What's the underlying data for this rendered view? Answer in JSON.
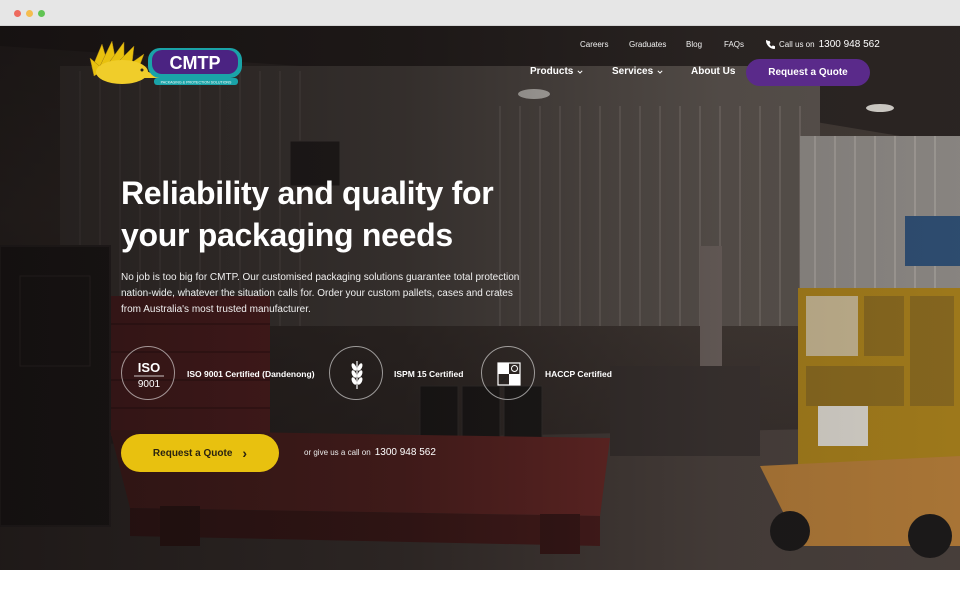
{
  "header": {
    "brand_name": "CMTP",
    "brand_tagline": "PACKAGING & PROTECTION SOLUTIONS",
    "utility_nav": [
      "Careers",
      "Graduates",
      "Blog",
      "FAQs"
    ],
    "call_prefix": "Call us on",
    "phone": "1300 948 562",
    "main_nav": [
      {
        "label": "Products",
        "has_dropdown": true
      },
      {
        "label": "Services",
        "has_dropdown": true
      },
      {
        "label": "About Us",
        "has_dropdown": false
      }
    ],
    "quote_button": "Request a Quote"
  },
  "hero": {
    "headline_line1": "Reliability and quality for",
    "headline_line2": "your packaging needs",
    "intro": "No job is too big for CMTP. Our customised packaging solutions guarantee total protection nation-wide, whatever the situation calls for. Order your custom pallets, cases and crates from Australia's most trusted manufacturer.",
    "certifications": [
      {
        "label": "ISO 9001 Certified (Dandenong)",
        "icon": "iso-9001-icon",
        "icon_text_top": "ISO",
        "icon_text_bottom": "9001"
      },
      {
        "label": "ISPM 15 Certified",
        "icon": "wheat-icon"
      },
      {
        "label": "HACCP Certified",
        "icon": "haccp-icon"
      }
    ],
    "cta_button": "Request a Quote",
    "cta_arrow": "›",
    "call_text": "or give us a call on",
    "call_phone": "1300 948 562"
  },
  "colors": {
    "accent_purple": "#5a2a8a",
    "accent_yellow": "#e8c10f",
    "logo_teal": "#1aa3a8"
  }
}
